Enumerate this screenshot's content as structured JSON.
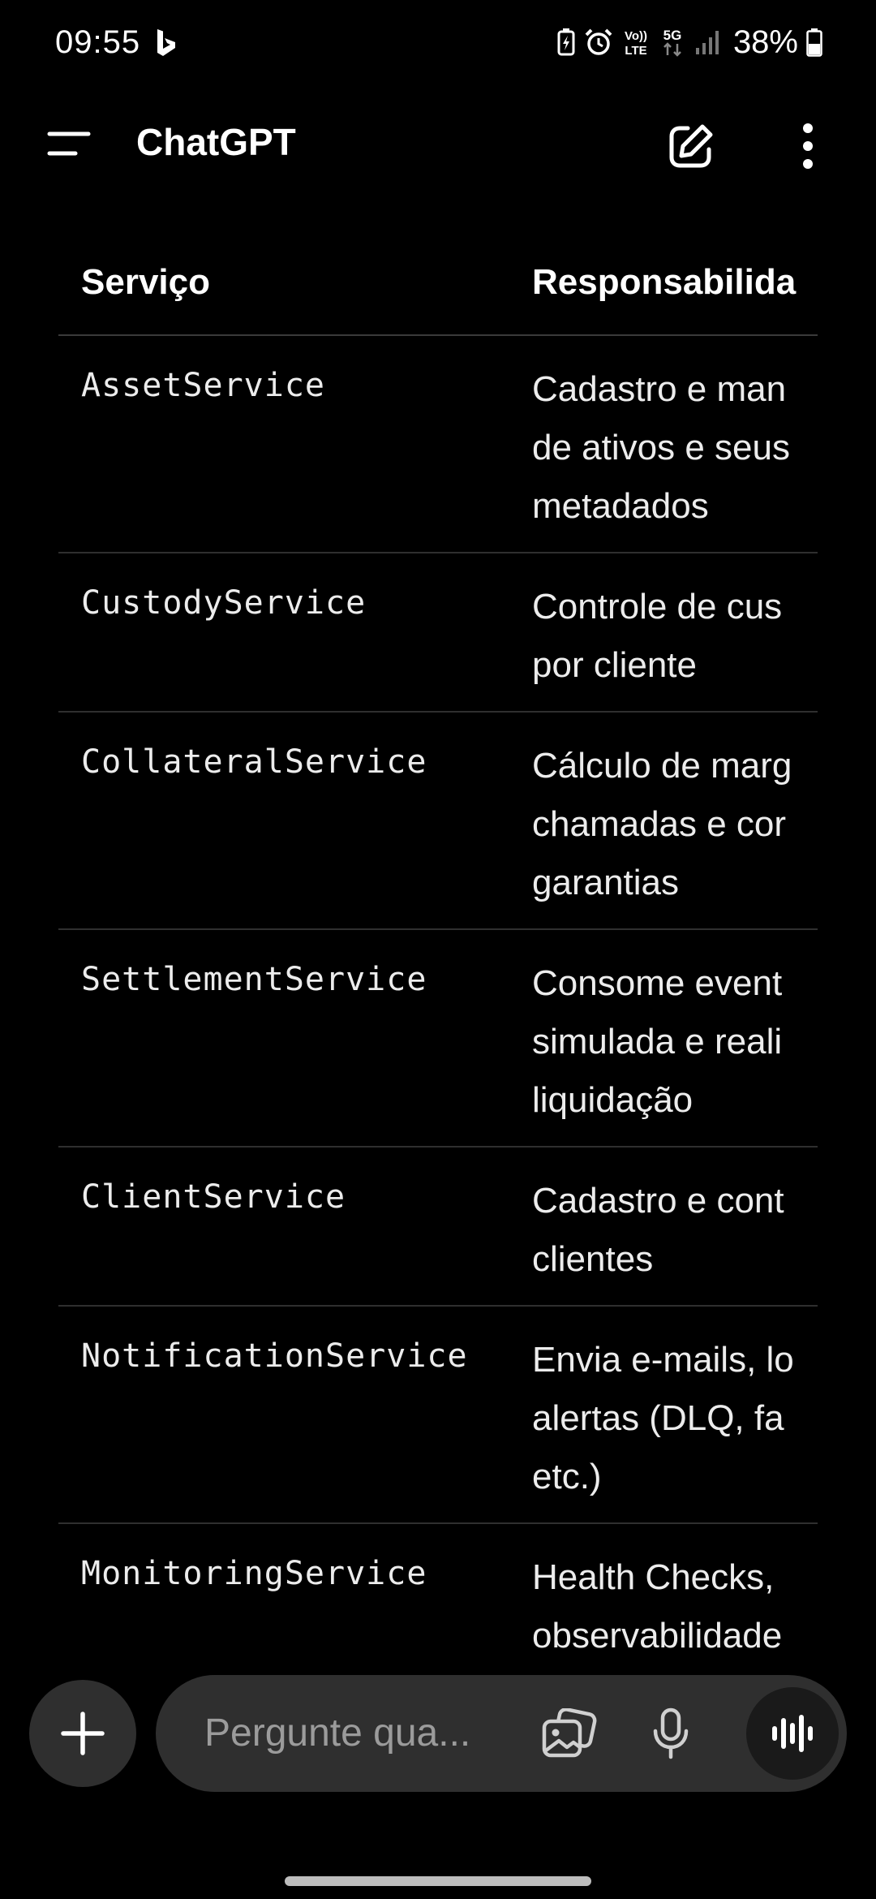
{
  "status_bar": {
    "time": "09:55",
    "battery_percent": "38%",
    "network": "5G",
    "volte": "VoLTE",
    "icons": [
      "bing-icon",
      "battery-saver-icon",
      "alarm-icon",
      "volte-icon",
      "5g-icon",
      "signal-icon",
      "battery-icon"
    ]
  },
  "app_bar": {
    "title": "ChatGPT",
    "icons": [
      "menu-icon",
      "new-chat-icon",
      "more-vertical-icon"
    ]
  },
  "table": {
    "headers": [
      "Serviço",
      "Responsabilida"
    ],
    "rows": [
      {
        "service": "AssetService",
        "responsibility": [
          "Cadastro e man",
          "de ativos e seus",
          "metadados"
        ]
      },
      {
        "service": "CustodyService",
        "responsibility": [
          "Controle de cus",
          "por cliente"
        ]
      },
      {
        "service": "CollateralService",
        "responsibility": [
          "Cálculo de marg",
          "chamadas e cor",
          "garantias"
        ]
      },
      {
        "service": "SettlementService",
        "responsibility": [
          "Consome event",
          "simulada e reali",
          "liquidação"
        ]
      },
      {
        "service": "ClientService",
        "responsibility": [
          "Cadastro e cont",
          "clientes"
        ]
      },
      {
        "service": "NotificationService",
        "responsibility": [
          "Envia e-mails, lo",
          "alertas (DLQ, fa",
          "etc.)"
        ]
      },
      {
        "service": "MonitoringService",
        "responsibility": [
          "Health Checks,",
          "observabilidade"
        ]
      }
    ]
  },
  "composer": {
    "placeholder": "Pergunte qua...",
    "icons": [
      "plus-icon",
      "image-icon",
      "microphone-icon",
      "voice-mode-icon"
    ]
  },
  "colors": {
    "background": "#000000",
    "text": "#ececec",
    "composer_bg": "#2f2f2f",
    "placeholder": "#9b9b9b",
    "divider": "#2f2f2f"
  }
}
